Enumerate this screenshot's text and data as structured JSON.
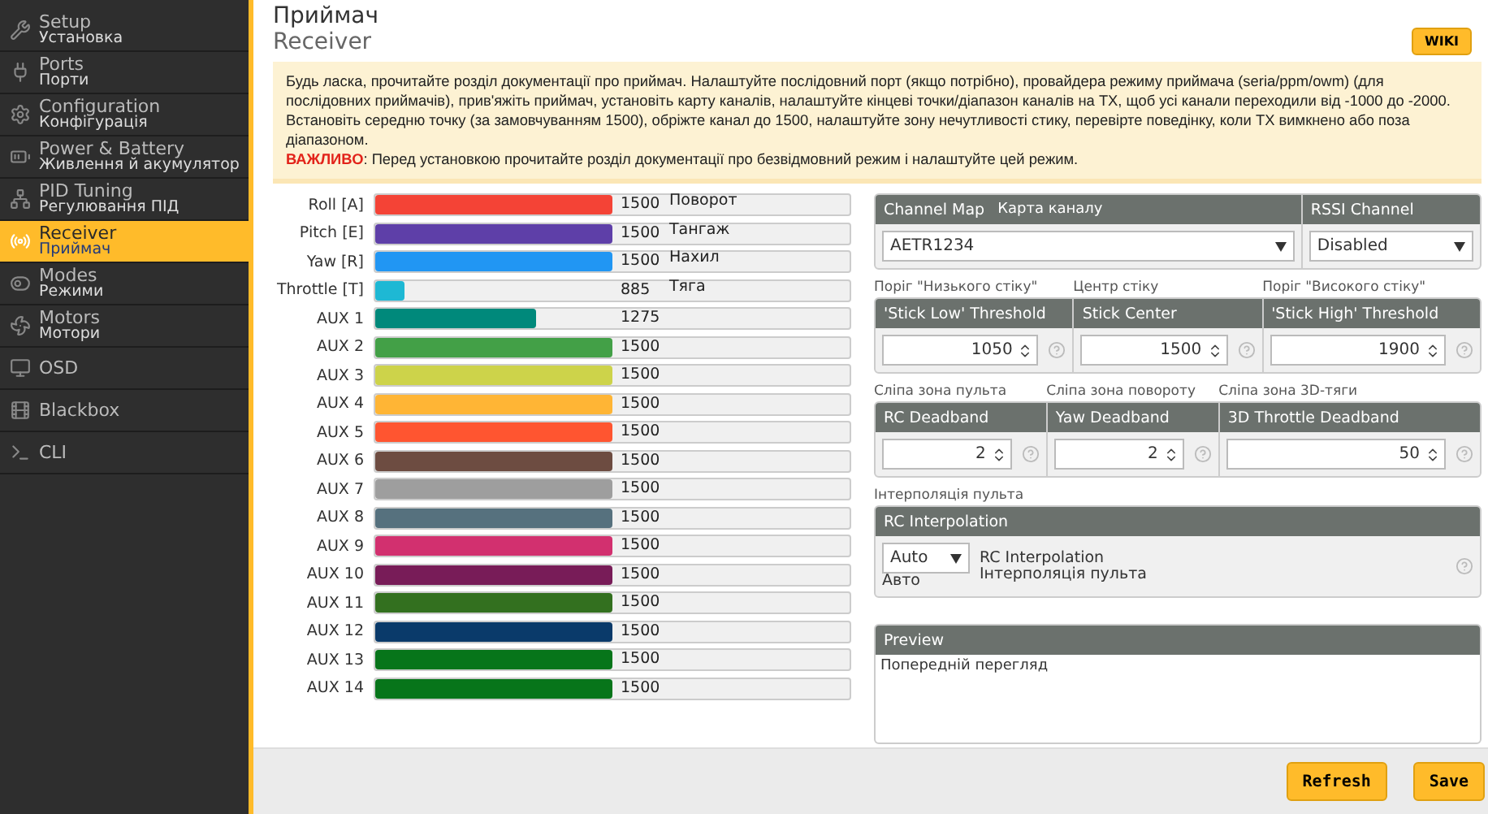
{
  "sidebar": {
    "items": [
      {
        "label": "Setup",
        "sublabel": "Установка",
        "selected": false
      },
      {
        "label": "Ports",
        "sublabel": "Порти",
        "selected": false
      },
      {
        "label": "Configuration",
        "sublabel": "Конфігурація",
        "selected": false
      },
      {
        "label": "Power & Battery",
        "sublabel": "Живлення й акумулятор",
        "selected": false
      },
      {
        "label": "PID Tuning",
        "sublabel": "Регулювання ПІД",
        "selected": false
      },
      {
        "label": "Receiver",
        "sublabel": "Приймач",
        "selected": true
      },
      {
        "label": "Modes",
        "sublabel": "Режими",
        "selected": false
      },
      {
        "label": "Motors",
        "sublabel": "Мотори",
        "selected": false
      },
      {
        "label": "OSD",
        "selected": false
      },
      {
        "label": "Blackbox",
        "selected": false
      },
      {
        "label": "CLI",
        "selected": false
      }
    ]
  },
  "page": {
    "title": "Приймач",
    "subtitle": "Receiver",
    "wiki_button": "WIKI"
  },
  "notice": {
    "text": "Будь ласка, прочитайте розділ документації про приймач. Налаштуйте послідовний порт (якщо потрібно), провайдера режиму приймача (seria/ppm/owm) (для послідовних приймачів), прив'яжіть приймач, установіть карту каналів, налаштуйте кінцеві точки/діапазон каналів на TX, щоб усі канали переходили від -1000 до -2000. Встановіть середню точку (за замовчуванням 1500), обріжте канал до 1500, налаштуйте зону нечутливості стику, перевірте поведінку, коли TX вимкнено або поза діапазоном.",
    "important_label": "ВАЖЛИВО",
    "important_text": ": Перед установкою прочитайте розділ документації про безвідмовний режим і налаштуйте цей режим."
  },
  "channels": [
    {
      "name": "Roll [A]",
      "value": "1500",
      "level": 0.5,
      "color": "#f44336",
      "note": "Поворот"
    },
    {
      "name": "Pitch [E]",
      "value": "1500",
      "level": 0.5,
      "color": "#5e3fa8",
      "note": "Тангаж"
    },
    {
      "name": "Yaw [R]",
      "value": "1500",
      "level": 0.5,
      "color": "#2196f3",
      "note": "Нахил"
    },
    {
      "name": "Throttle [T]",
      "value": "885",
      "level": 0.06,
      "color": "#1eb8d4",
      "note": "Тяга"
    },
    {
      "name": "AUX 1",
      "value": "1275",
      "level": 0.34,
      "color": "#00897b"
    },
    {
      "name": "AUX 2",
      "value": "1500",
      "level": 0.5,
      "color": "#43a047"
    },
    {
      "name": "AUX 3",
      "value": "1500",
      "level": 0.5,
      "color": "#cdd34a"
    },
    {
      "name": "AUX 4",
      "value": "1500",
      "level": 0.5,
      "color": "#ffb535"
    },
    {
      "name": "AUX 5",
      "value": "1500",
      "level": 0.5,
      "color": "#ff5530"
    },
    {
      "name": "AUX 6",
      "value": "1500",
      "level": 0.5,
      "color": "#6d4c41"
    },
    {
      "name": "AUX 7",
      "value": "1500",
      "level": 0.5,
      "color": "#9e9e9e"
    },
    {
      "name": "AUX 8",
      "value": "1500",
      "level": 0.5,
      "color": "#56717e"
    },
    {
      "name": "AUX 9",
      "value": "1500",
      "level": 0.5,
      "color": "#d2306f"
    },
    {
      "name": "AUX 10",
      "value": "1500",
      "level": 0.5,
      "color": "#781c58"
    },
    {
      "name": "AUX 11",
      "value": "1500",
      "level": 0.5,
      "color": "#33701f"
    },
    {
      "name": "AUX 12",
      "value": "1500",
      "level": 0.5,
      "color": "#0a3a6a"
    },
    {
      "name": "AUX 13",
      "value": "1500",
      "level": 0.5,
      "color": "#07751a"
    },
    {
      "name": "AUX 14",
      "value": "1500",
      "level": 0.5,
      "color": "#07751a"
    }
  ],
  "channel_map": {
    "header": "Channel Map",
    "header_note": "Карта каналу",
    "value": "AETR1234"
  },
  "rssi": {
    "header": "RSSI Channel",
    "value": "Disabled"
  },
  "thresholds": [
    {
      "caption": "Поріг \"Низького стіку\"",
      "header": "'Stick Low' Threshold",
      "value": "1050"
    },
    {
      "caption": "Центр стіку",
      "header": "Stick Center",
      "value": "1500"
    },
    {
      "caption": "Поріг \"Високого стіку\"",
      "header": "'Stick High' Threshold",
      "value": "1900"
    }
  ],
  "deadbands": [
    {
      "caption": "Сліпа зона пульта",
      "header": "RC Deadband",
      "value": "2"
    },
    {
      "caption": "Сліпа зона повороту",
      "header": "Yaw Deadband",
      "value": "2"
    },
    {
      "caption": "Сліпа зона 3D-тяги",
      "header": "3D Throttle Deadband",
      "value": "50"
    }
  ],
  "interpolation": {
    "caption": "Інтерполяція пульта",
    "header": "RC Interpolation",
    "value": "Auto",
    "value_note": "Авто",
    "label": "RC Interpolation",
    "label_note": "Інтерполяція пульта"
  },
  "preview": {
    "header": "Preview",
    "text": "Попередній перегляд"
  },
  "footer": {
    "buttons": [
      "Refresh",
      "Save"
    ]
  }
}
